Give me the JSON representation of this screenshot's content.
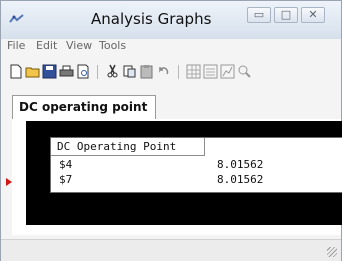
{
  "window": {
    "title": "Analysis Graphs"
  },
  "menu": [
    "File",
    "Edit",
    "View",
    "Tools"
  ],
  "toolbar": {
    "buttons": [
      "new-icon",
      "open-icon",
      "save-icon",
      "print-icon",
      "print-preview-icon",
      "cut-icon",
      "copy-icon",
      "paste-icon",
      "undo-icon",
      "grid-icon",
      "list-icon",
      "chart-icon",
      "zoom-icon"
    ]
  },
  "tab": {
    "label": "DC operating point"
  },
  "table": {
    "header": "DC Operating Point",
    "rows": [
      {
        "name": "$4",
        "value": "8.01562"
      },
      {
        "name": "$7",
        "value": "8.01562"
      }
    ]
  }
}
